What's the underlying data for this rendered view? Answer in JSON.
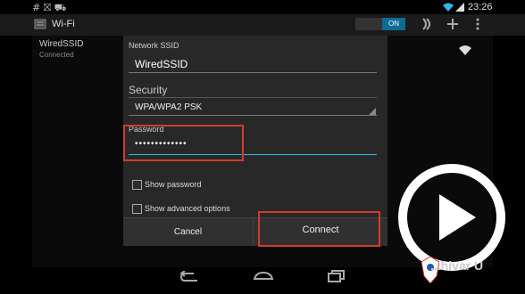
{
  "status_bar": {
    "left_icons": "# ⛝ ⛟",
    "time": "23:26"
  },
  "action_bar": {
    "title": "Wi-Fi",
    "toggle_label": "ON"
  },
  "network": {
    "name": "WiredSSID",
    "status": "Connected"
  },
  "dialog": {
    "ssid_label": "Network SSID",
    "ssid_value": "WiredSSID",
    "security_label": "Security",
    "security_value": "WPA/WPA2 PSK",
    "password_label": "Password",
    "password_value": "•••••••••••••",
    "show_password_label": "Show password",
    "advanced_label": "Show advanced options",
    "cancel_label": "Cancel",
    "connect_label": "Connect"
  },
  "watermark": {
    "text": "...hivar U"
  },
  "colors": {
    "accent": "#33b5e5",
    "highlight": "#d33b2b"
  }
}
